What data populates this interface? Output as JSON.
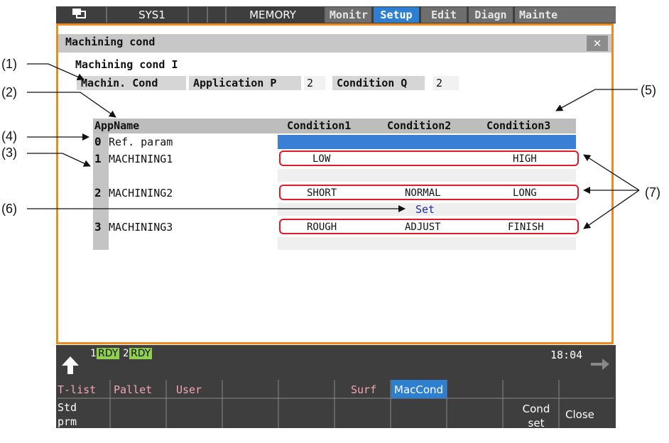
{
  "topbar": {
    "system": "SYS1",
    "mode": "MEMORY",
    "tabs": [
      "Monitr",
      "Setup",
      "Edit",
      "Diagn",
      "Mainte"
    ],
    "active_tab": "Setup"
  },
  "window": {
    "title": "Machining cond",
    "close_glyph": "✕",
    "subtitle": "Machining cond I"
  },
  "params": {
    "machin_cond_label": "Machin. Cond",
    "app_p_label": "Application P",
    "app_p_value": "2",
    "cond_q_label": "Condition Q",
    "cond_q_value": "2"
  },
  "table": {
    "headers": [
      "AppName",
      "Condition1",
      "Condition2",
      "Condition3"
    ],
    "rows": [
      {
        "num": "0",
        "name": "Ref. param",
        "c1": "",
        "c2": "",
        "c3": ""
      },
      {
        "num": "1",
        "name": "MACHINING1",
        "c1": "LOW",
        "c2": "",
        "c3": "HIGH"
      },
      {
        "num": "2",
        "name": "MACHINING2",
        "c1": "SHORT",
        "c2": "NORMAL",
        "c3": "LONG"
      },
      {
        "num": "3",
        "name": "MACHINING3",
        "c1": "ROUGH",
        "c2": "ADJUST",
        "c3": "FINISH"
      }
    ],
    "set_label": "Set"
  },
  "callouts": [
    "(1)",
    "(2)",
    "(3)",
    "(4)",
    "(5)",
    "(6)",
    "(7)"
  ],
  "status": {
    "sys1_num": "1",
    "sys1_state": "RDY",
    "sys2_num": "2",
    "sys2_state": "RDY",
    "time": "18:04"
  },
  "softkeys": {
    "top": [
      "T-list",
      "Pallet",
      "User",
      "",
      "",
      "Surf",
      "MacCond",
      "",
      "",
      ""
    ],
    "bottom": [
      "Std prm select",
      "",
      "",
      "",
      "",
      "",
      "",
      "",
      "Cond set",
      "Close"
    ]
  },
  "colors": {
    "accent_tab": "#2f7fd0",
    "window_border": "#f08a1c",
    "highlight_row": "#3a7fd5",
    "callout_box": "#e0192b",
    "rdy_green": "#8fd14f"
  }
}
